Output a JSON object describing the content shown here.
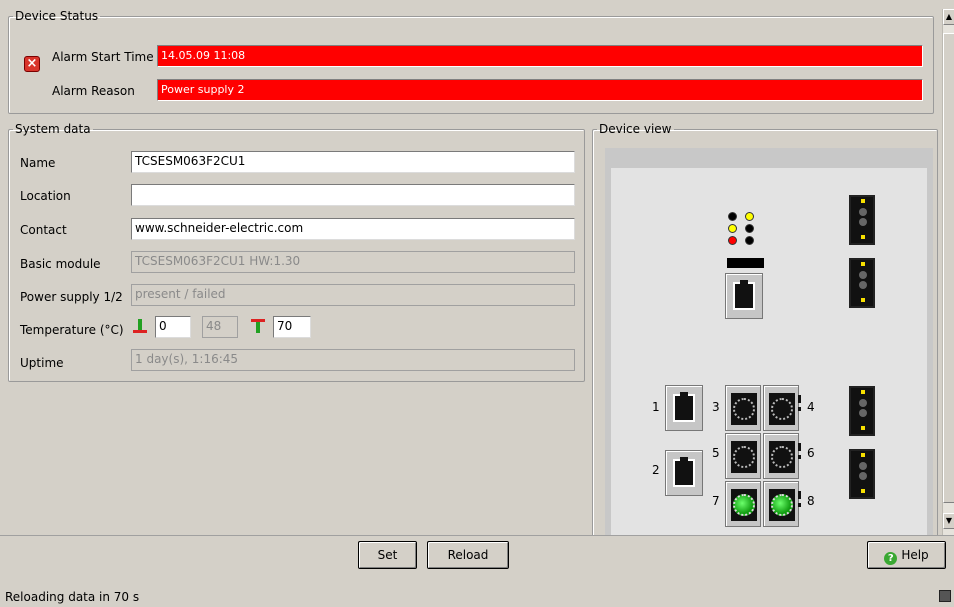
{
  "device_status": {
    "legend": "Device Status",
    "alarm_icon": "error-x-icon",
    "alarm_start_label": "Alarm Start Time",
    "alarm_start_value": "14.05.09 11:08",
    "alarm_reason_label": "Alarm Reason",
    "alarm_reason_value": "Power supply 2",
    "alarm_color": "#ff0000"
  },
  "system_data": {
    "legend": "System data",
    "name_label": "Name",
    "name_value": "TCSESM063F2CU1",
    "location_label": "Location",
    "location_value": "",
    "contact_label": "Contact",
    "contact_value": "www.schneider-electric.com",
    "basic_module_label": "Basic module",
    "basic_module_value": "TCSESM063F2CU1 HW:1.30",
    "power_supply_label": "Power supply 1/2",
    "power_supply_value": "present / failed",
    "temperature_label": "Temperature (°C)",
    "temp_min": "0",
    "temp_current": "48",
    "temp_max": "70",
    "uptime_label": "Uptime",
    "uptime_value": "1 day(s), 1:16:45"
  },
  "device_view": {
    "legend": "Device view",
    "ports": [
      "1",
      "2",
      "3",
      "4",
      "5",
      "6",
      "7",
      "8"
    ],
    "led_colors": [
      "#000000",
      "#ffff00",
      "#ffff00",
      "#000000",
      "#ff0000",
      "#000000"
    ]
  },
  "buttons": {
    "set": "Set",
    "reload": "Reload",
    "help": "Help"
  },
  "status_bar": {
    "text": "Reloading data in 70 s"
  }
}
